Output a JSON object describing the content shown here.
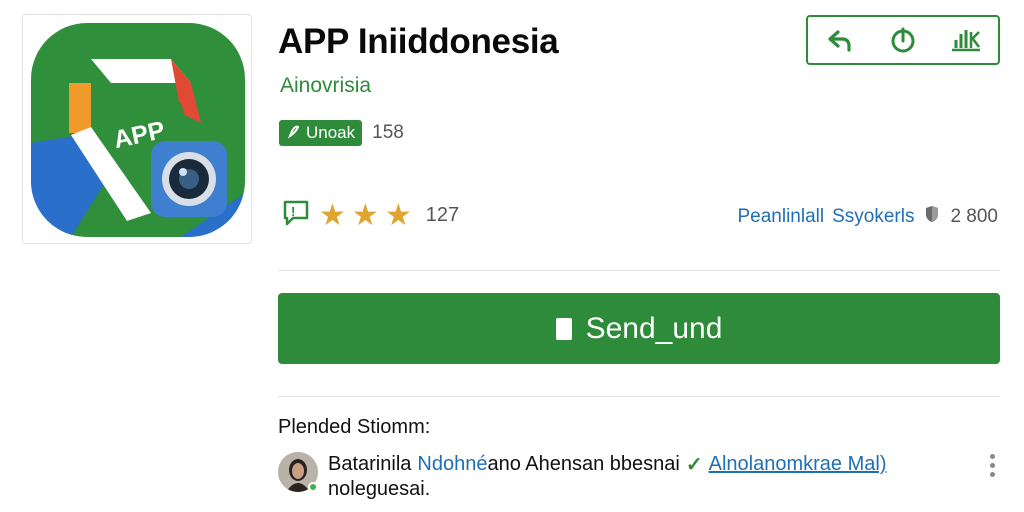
{
  "app": {
    "title": "APP Iniiddonesia",
    "developer": "Ainovrisia",
    "icon_label": "APP",
    "badge_label": "Unoak",
    "badge_count": "158",
    "rating_count": "127",
    "stars": 3
  },
  "meta": {
    "left_link": "Peanlinlall",
    "mid_text": "Ssyokerls",
    "count": "2 800"
  },
  "actions": {
    "icons": [
      "reply-icon",
      "timer-icon",
      "chart-icon"
    ]
  },
  "primary_button": {
    "label": "Send_und"
  },
  "section": {
    "title": "Plended Stiomm:"
  },
  "comment": {
    "name": "Batarinila",
    "highlight": "Ndohné",
    "text": "ano Ahensan bbesnai",
    "link": "Alnolanomkrae Mal)",
    "line2": "noleguesai."
  },
  "colors": {
    "accent": "#2e8b3a",
    "link": "#1f6fb5",
    "star": "#e0a531"
  }
}
